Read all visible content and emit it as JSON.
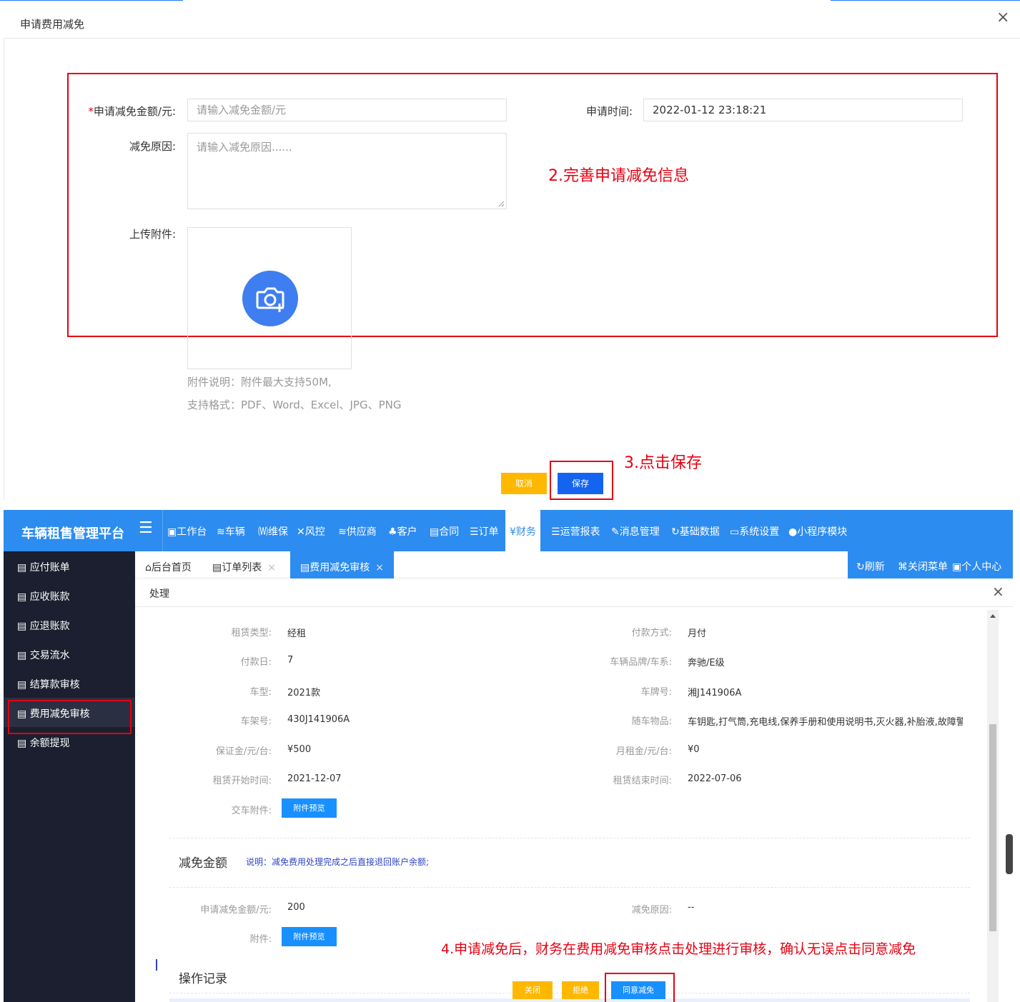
{
  "dialog": {
    "title": "申请费用减免",
    "close": "×",
    "required_mark": "*",
    "amount_label": "申请减免金额/元:",
    "amount_placeholder": "请输入减免金额/元",
    "time_label": "申请时间:",
    "time_value": "2022-01-12 23:18:21",
    "reason_label": "减免原因:",
    "reason_placeholder": "请输入减免原因......",
    "upload_label": "上传附件:",
    "hint1": "附件说明：附件最大支持50M,",
    "hint2": "支持格式：PDF、Word、Excel、JPG、PNG",
    "cancel_label": "取消",
    "save_label": "保存",
    "annot_step2": "2.完善申请减免信息",
    "annot_step3": "3.点击保存"
  },
  "app": {
    "brand": "车辆租售管理平台",
    "menu_icon": "☰",
    "nav": [
      {
        "icon": "workbench-icon",
        "label": "工作台"
      },
      {
        "icon": "layers-icon",
        "label": "车辆"
      },
      {
        "icon": "doc-w-icon",
        "label": "维保"
      },
      {
        "icon": "tools-icon",
        "label": "风控"
      },
      {
        "icon": "layers-icon",
        "label": "供应商"
      },
      {
        "icon": "users-icon",
        "label": "客户"
      },
      {
        "icon": "file-icon",
        "label": "合同"
      },
      {
        "icon": "list-icon",
        "label": "订单"
      },
      {
        "icon": "yen-icon",
        "label": "财务"
      },
      {
        "icon": "list-icon",
        "label": "运营报表"
      },
      {
        "icon": "edit-icon",
        "label": "消息管理"
      },
      {
        "icon": "refresh-icon",
        "label": "基础数据"
      },
      {
        "icon": "monitor-icon",
        "label": "系统设置"
      },
      {
        "icon": "miniprogram-icon",
        "label": "小程序模块"
      }
    ],
    "sidebar": [
      "应付账单",
      "应收账款",
      "应退账款",
      "交易流水",
      "结算款审核",
      "费用减免审核",
      "余额提现"
    ],
    "tabs": {
      "home": "后台首页",
      "orders": "订单列表",
      "active": "费用减免审核",
      "close": "×"
    },
    "tools": {
      "refresh": "刷新",
      "close_menu": "关闭菜单",
      "profile": "个人中心"
    },
    "panel_title": "处理",
    "panel_close": "×",
    "details": {
      "lease_type_label": "租赁类型:",
      "lease_type": "经租",
      "pay_method_label": "付款方式:",
      "pay_method": "月付",
      "pay_day_label": "付款日:",
      "pay_day": "7",
      "brand_label": "车辆品牌/车系:",
      "brand_val": "奔驰/E级",
      "model_label": "车型:",
      "model": "2021款",
      "plate_label": "车牌号:",
      "plate": "湘J141906A",
      "vin_label": "车架号:",
      "vin": "430J141906A",
      "items_label": "随车物品:",
      "items": "车钥匙,打气筒,充电线,保养手册和使用说明书,灭火器,补胎液,故障警",
      "deposit_label": "保证金/元/台:",
      "deposit": "¥500",
      "rent_label": "月租金/元/台:",
      "rent": "¥0",
      "start_label": "租赁开始时间:",
      "start": "2021-12-07",
      "end_label": "租赁结束时间:",
      "end": "2022-07-06",
      "delivery_label": "交车附件:",
      "preview_label": "附件预览"
    },
    "reduction": {
      "title": "减免金额",
      "note": "说明：减免费用处理完成之后直接退回账户余额;",
      "amount_label": "申请减免金额/元:",
      "amount": "200",
      "reason_label": "减免原因:",
      "reason": "--",
      "attach_label": "附件:",
      "preview_label": "附件预览"
    },
    "log_title": "操作记录",
    "buttons": {
      "close": "关闭",
      "reject": "拒绝",
      "agree": "同意减免"
    },
    "annot_step4": "4.申请减免后，财务在费用减免审核点击处理进行审核，确认无误点击同意减免"
  }
}
